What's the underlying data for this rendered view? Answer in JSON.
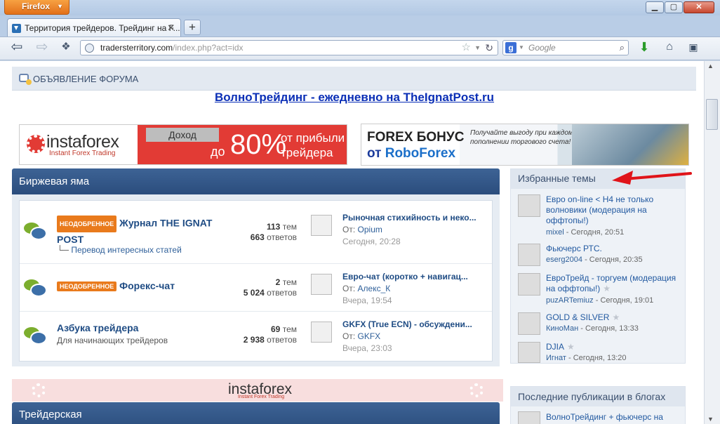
{
  "browser": {
    "menu_button": "Firefox",
    "tab_title": "Территория трейдеров. Трейдинг на F...",
    "url_host": "tradersterritory.com",
    "url_path": "/index.php?act=idx",
    "search_placeholder": "Google"
  },
  "page": {
    "announcement": "ОБЪЯВЛЕНИЕ ФОРУМА",
    "headline": "ВолноТрейдинг - ежедневно на TheIgnatPost.ru",
    "banner1": {
      "logo": "instaforex",
      "logo_sub": "Instant Forex Trading",
      "label": "Доход",
      "prefix": "до",
      "percent": "80%",
      "tail": "от прибыли трейдера"
    },
    "banner2": {
      "line1": "FOREX БОНУС",
      "line2_prefix": "от",
      "line2_brand": "RoboForex",
      "small": "Получайте выгоду при каждом пополнении торгового счета!"
    },
    "banner3": {
      "logo": "instaforex",
      "logo_sub": "Instant Forex Trading"
    },
    "category1": "Биржевая яма",
    "category2": "Трейдерская",
    "forums": [
      {
        "badge": "НЕОДОБРЕННОЕ",
        "name": "Журнал THE IGNAT POST",
        "sub": "Перевод интересных статей",
        "topics": "113",
        "topics_label": "тем",
        "replies": "663",
        "replies_label": "ответов",
        "last_title": "Рыночная стихийность и неко...",
        "last_by_label": "От:",
        "last_by": "Opium",
        "last_date": "Сегодня, 20:28"
      },
      {
        "badge": "НЕОДОБРЕННОЕ",
        "name": "Форекс-чат",
        "sub": "",
        "topics": "2",
        "topics_label": "тем",
        "replies": "5 024",
        "replies_label": "ответов",
        "last_title": "Евро-чат (коротко + навигац...",
        "last_by_label": "От:",
        "last_by": "Алекс_К",
        "last_date": "Вчера, 19:54"
      },
      {
        "badge": "",
        "name": "Азбука трейдера",
        "sub": "Для начинающих трейдеров",
        "topics": "69",
        "topics_label": "тем",
        "replies": "2 938",
        "replies_label": "ответов",
        "last_title": "GKFX (True ECN) - обсуждени...",
        "last_by_label": "От:",
        "last_by": "GKFX",
        "last_date": "Вчера, 23:03"
      }
    ],
    "favorites": {
      "title": "Избранные темы",
      "items": [
        {
          "title": "Евро on-line < H4 не только волновики (модерация на оффтопы!)",
          "author": "mixel",
          "date": "- Сегодня, 20:51"
        },
        {
          "title": "Фьючерс РТС.",
          "author": "eserg2004",
          "date": "- Сегодня, 20:35"
        },
        {
          "title": "ЕвроТрейд - торгуем (модерация на оффтопы!)",
          "author": "puzARTemiuz",
          "date": "- Сегодня, 19:01"
        },
        {
          "title": "GOLD & SILVER",
          "author": "КиноМан",
          "date": "- Сегодня, 13:33"
        },
        {
          "title": "DJIA",
          "author": "Игнат",
          "date": "- Сегодня, 13:20"
        }
      ]
    },
    "blogs": {
      "title": "Последние публикации в блогах",
      "first_item": "ВолноТрейдинг + фьючерс на"
    }
  }
}
